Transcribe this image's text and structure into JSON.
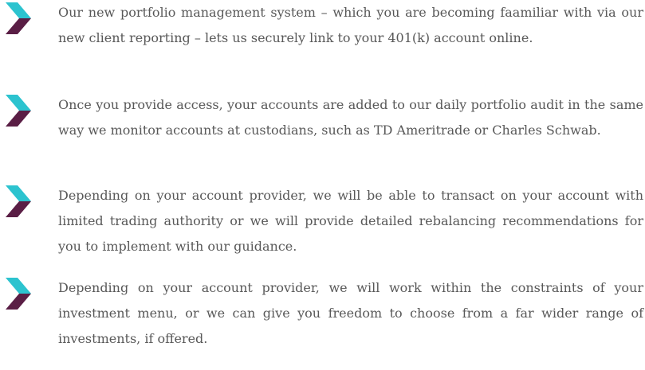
{
  "colors": {
    "chevron_top": "#2cc3cf",
    "chevron_bottom": "#5a1e45",
    "text": "#585858",
    "background": "#ffffff"
  },
  "bullets": [
    {
      "icon": "chevron-right-icon",
      "text": "Our new portfolio management system – which you are becoming fa­amiliar with via our new client reporting – lets us securely link to your 401(k) account online."
    },
    {
      "icon": "chevron-right-icon",
      "text": "Once you provide access, your accounts are added to our daily portfolio audit in the same way we monitor accounts at custodians, such as TD Ameritrade or Charles Schwab."
    },
    {
      "icon": "chevron-right-icon",
      "text": "Depending on your account provider, we will be able to transact on your account with limited trading authority or we will provide detailed re­balancing recommendations for you to implement with our guidance."
    },
    {
      "icon": "chevron-right-icon",
      "text": "Depending on your account provider, we will work within the constraints of your investment menu, or we can give you freedom to choose from a far wider range of investments, if offered."
    }
  ]
}
